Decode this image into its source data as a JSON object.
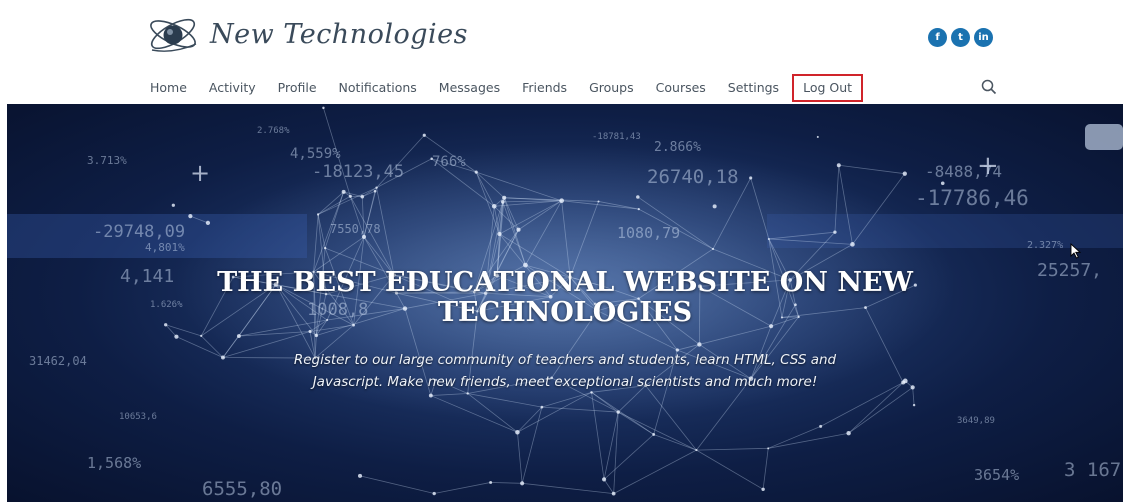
{
  "brand": {
    "name": "New Technologies",
    "icon": "atom-globe-logo-icon"
  },
  "social": [
    {
      "icon": "facebook-icon",
      "glyph": "f"
    },
    {
      "icon": "twitter-icon",
      "glyph": "t"
    },
    {
      "icon": "linkedin-icon",
      "glyph": "in"
    }
  ],
  "nav": {
    "items": [
      "Home",
      "Activity",
      "Profile",
      "Notifications",
      "Messages",
      "Friends",
      "Groups",
      "Courses",
      "Settings",
      "Log Out"
    ],
    "highlighted": "Log Out",
    "highlight_color": "#d0242a"
  },
  "search": {
    "icon": "search-icon"
  },
  "hero": {
    "title_line1": "THE BEST EDUCATIONAL WEBSITE ON NEW",
    "title_line2": "TECHNOLOGIES",
    "subtitle_line1": "Register to our large community of teachers and students, learn HTML, CSS and",
    "subtitle_line2": "Javascript. Make new friends, meet exceptional scientists and much more!",
    "background_numbers": [
      "3.713%",
      "2.768%",
      "4,559%",
      "-18123,45",
      "766%",
      "-18781,43",
      "2.866%",
      "26740,18",
      "-8488,74",
      "-17786,46",
      "-29748,09",
      "4,801%",
      "7550,78",
      "1080,79",
      "2.327%",
      "4,141",
      "1.626%",
      "1008,8",
      "25257,",
      "31462,04",
      "10653,6",
      "1,568%",
      "6555,80",
      "3649,89",
      "3654%",
      "3 167"
    ]
  },
  "colors": {
    "nav_text": "#4a5560",
    "social": "#1a72b0",
    "hero_bg": "#0e1e45"
  }
}
